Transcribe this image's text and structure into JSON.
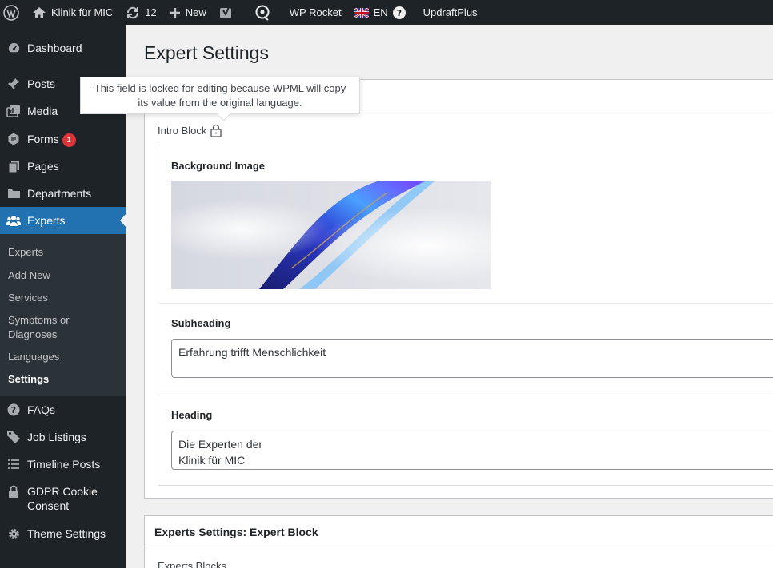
{
  "adminbar": {
    "site_name": "Klinik für MIC",
    "updates_count": "12",
    "new_label": "New",
    "wp_rocket": "WP Rocket",
    "language": "EN",
    "updraftplus": "UpdraftPlus"
  },
  "sidebar": {
    "items": [
      {
        "label": "Dashboard",
        "icon": "dashboard-icon"
      },
      {
        "label": "Posts",
        "icon": "pin-icon"
      },
      {
        "label": "Media",
        "icon": "media-icon"
      },
      {
        "label": "Forms",
        "icon": "forms-icon",
        "badge": "1"
      },
      {
        "label": "Pages",
        "icon": "pages-icon"
      },
      {
        "label": "Departments",
        "icon": "folder-icon"
      },
      {
        "label": "Experts",
        "icon": "group-icon"
      },
      {
        "label": "FAQs",
        "icon": "help-icon"
      },
      {
        "label": "Job Listings",
        "icon": "tag-icon"
      },
      {
        "label": "Timeline Posts",
        "icon": "list-icon"
      },
      {
        "label": "GDPR Cookie Consent",
        "icon": "lock-icon"
      },
      {
        "label": "Theme Settings",
        "icon": "gear-icon"
      }
    ],
    "submenu": [
      {
        "label": "Experts"
      },
      {
        "label": "Add New"
      },
      {
        "label": "Services"
      },
      {
        "label": "Symptoms or Diagnoses"
      },
      {
        "label": "Languages"
      },
      {
        "label": "Settings"
      }
    ]
  },
  "main": {
    "page_title": "Expert Settings",
    "tooltip": "This field is locked for editing because WPML will copy its value from the original language.",
    "intro_block_label": "Intro Block",
    "fields": {
      "background_image_label": "Background Image",
      "subheading_label": "Subheading",
      "subheading_value": "Erfahrung trifft Menschlichkeit",
      "heading_label": "Heading",
      "heading_line1": "Die Experten der",
      "heading_line2": "Klinik für MIC"
    },
    "second_box_title": "Experts Settings: Expert Block",
    "second_box_sub": "Experts Blocks"
  },
  "colors": {
    "admin_bg": "#1d2327",
    "accent": "#2271b1",
    "badge": "#d63638"
  }
}
